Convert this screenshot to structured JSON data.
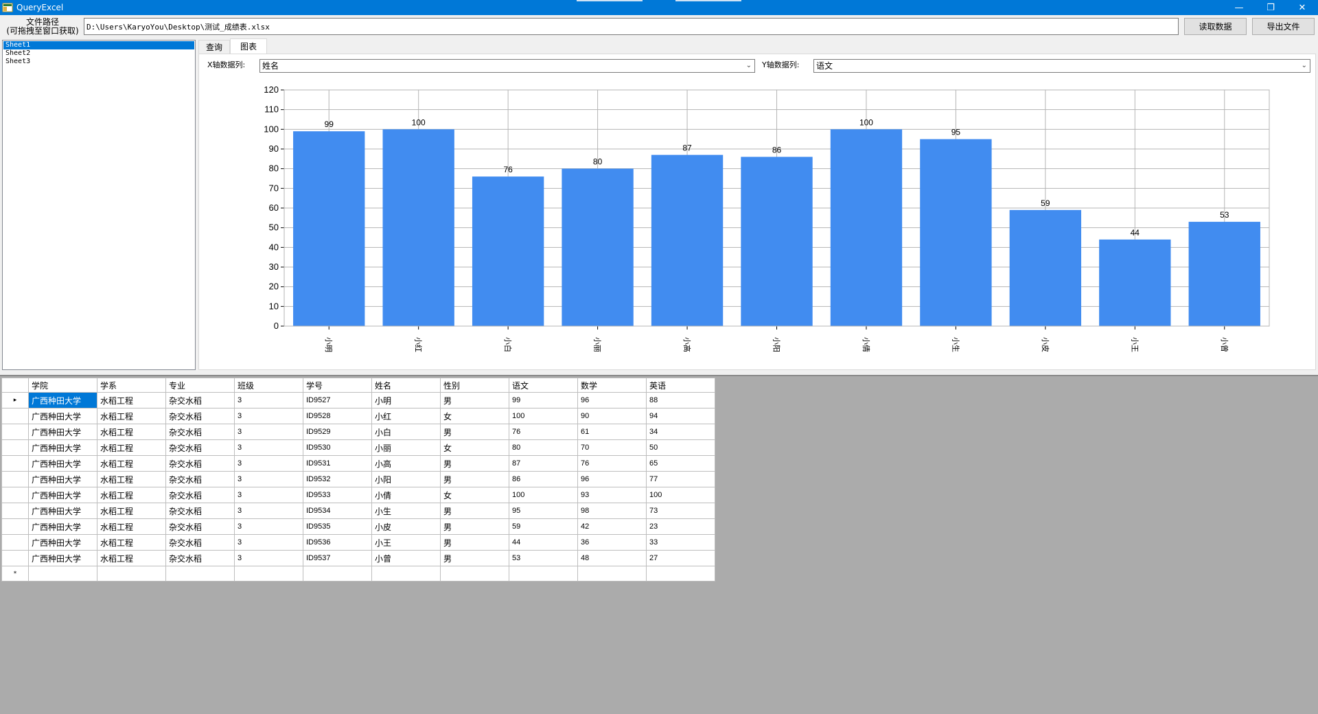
{
  "window": {
    "title": "QueryExcel",
    "minimize": "—",
    "maximize": "❐",
    "close": "✕"
  },
  "toolbar": {
    "path_label_line1": "文件路径",
    "path_label_line2": "(可拖拽至窗口获取)",
    "path_value": "D:\\Users\\KaryoYou\\Desktop\\测试_成绩表.xlsx",
    "read_button": "读取数据",
    "export_button": "导出文件"
  },
  "sheets": [
    "Sheet1",
    "Sheet2",
    "Sheet3"
  ],
  "tabs": {
    "query": "查询",
    "chart": "图表"
  },
  "chart_controls": {
    "x_label": "X轴数据列:",
    "x_value": "姓名",
    "y_label": "Y轴数据列:",
    "y_value": "语文"
  },
  "chart_data": {
    "type": "bar",
    "categories": [
      "小明",
      "小红",
      "小白",
      "小丽",
      "小高",
      "小阳",
      "小倩",
      "小生",
      "小皮",
      "小王",
      "小曾"
    ],
    "values": [
      99,
      100,
      76,
      80,
      87,
      86,
      100,
      95,
      59,
      44,
      53
    ],
    "ylim": [
      0,
      120
    ],
    "yticks": [
      0,
      10,
      20,
      30,
      40,
      50,
      60,
      70,
      80,
      90,
      100,
      110,
      120
    ],
    "grid": true,
    "bar_color": "#418cf0",
    "show_value_labels": true
  },
  "table": {
    "headers": [
      "学院",
      "学系",
      "专业",
      "班级",
      "学号",
      "姓名",
      "性别",
      "语文",
      "数学",
      "英语"
    ],
    "rows": [
      [
        "广西种田大学",
        "水稻工程",
        "杂交水稻",
        "3",
        "ID9527",
        "小明",
        "男",
        "99",
        "96",
        "88"
      ],
      [
        "广西种田大学",
        "水稻工程",
        "杂交水稻",
        "3",
        "ID9528",
        "小红",
        "女",
        "100",
        "90",
        "94"
      ],
      [
        "广西种田大学",
        "水稻工程",
        "杂交水稻",
        "3",
        "ID9529",
        "小白",
        "男",
        "76",
        "61",
        "34"
      ],
      [
        "广西种田大学",
        "水稻工程",
        "杂交水稻",
        "3",
        "ID9530",
        "小丽",
        "女",
        "80",
        "70",
        "50"
      ],
      [
        "广西种田大学",
        "水稻工程",
        "杂交水稻",
        "3",
        "ID9531",
        "小高",
        "男",
        "87",
        "76",
        "65"
      ],
      [
        "广西种田大学",
        "水稻工程",
        "杂交水稻",
        "3",
        "ID9532",
        "小阳",
        "男",
        "86",
        "96",
        "77"
      ],
      [
        "广西种田大学",
        "水稻工程",
        "杂交水稻",
        "3",
        "ID9533",
        "小倩",
        "女",
        "100",
        "93",
        "100"
      ],
      [
        "广西种田大学",
        "水稻工程",
        "杂交水稻",
        "3",
        "ID9534",
        "小生",
        "男",
        "95",
        "98",
        "73"
      ],
      [
        "广西种田大学",
        "水稻工程",
        "杂交水稻",
        "3",
        "ID9535",
        "小皮",
        "男",
        "59",
        "42",
        "23"
      ],
      [
        "广西种田大学",
        "水稻工程",
        "杂交水稻",
        "3",
        "ID9536",
        "小王",
        "男",
        "44",
        "36",
        "33"
      ],
      [
        "广西种田大学",
        "水稻工程",
        "杂交水稻",
        "3",
        "ID9537",
        "小曾",
        "男",
        "53",
        "48",
        "27"
      ]
    ],
    "current_row_marker": "▸",
    "new_row_marker": "*"
  }
}
